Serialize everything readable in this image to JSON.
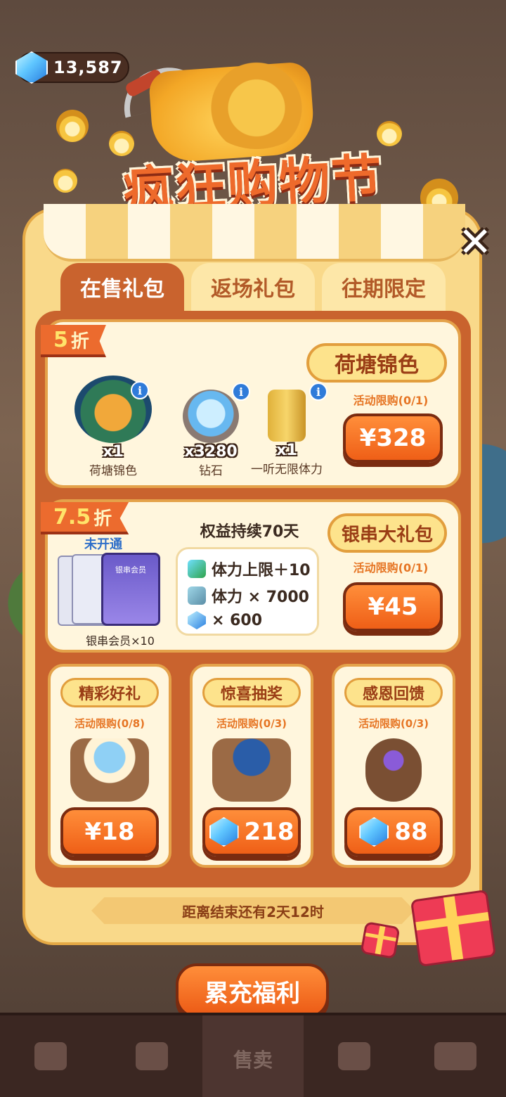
{
  "currency": {
    "amount": "13,587",
    "icon": "diamond-icon"
  },
  "header": {
    "title": "疯狂购物节"
  },
  "close": {
    "label": "✕"
  },
  "tabs": [
    {
      "label": "在售礼包",
      "active": true
    },
    {
      "label": "返场礼包",
      "active": false
    },
    {
      "label": "往期限定",
      "active": false
    }
  ],
  "pack1": {
    "discount_num": "5",
    "discount_unit": "折",
    "name": "荷塘锦色",
    "limit": "活动限购(0/1)",
    "price": "¥328",
    "items": [
      {
        "qty": "x1",
        "label": "荷塘锦色",
        "icon": "koi-fish-icon"
      },
      {
        "qty": "x3280",
        "label": "钻石",
        "icon": "diamond-pile-icon"
      },
      {
        "qty": "x1",
        "label": "一听无限体力",
        "icon": "energy-can-icon"
      }
    ]
  },
  "pack2": {
    "discount_num": "7.5",
    "discount_unit": "折",
    "name": "银串大礼包",
    "limit": "活动限购(0/1)",
    "price": "¥45",
    "status": "未开通",
    "duration": "权益持续70天",
    "member_label": "银串会员×10",
    "card_text": "银串会员",
    "benefits": [
      {
        "text": "体力上限＋10",
        "icon": "energy-up-icon"
      },
      {
        "text": "体力 × 7000",
        "icon": "battery-icon"
      },
      {
        "text": "× 600",
        "icon": "diamond-icon"
      }
    ]
  },
  "small_packs": [
    {
      "title": "精彩好礼",
      "limit": "活动限购(0/8)",
      "price": "¥18",
      "gem": false,
      "icon": "gift-basket-icon"
    },
    {
      "title": "惊喜抽奖",
      "limit": "活动限购(0/3)",
      "price": "218",
      "gem": true,
      "icon": "lottery-basket-icon"
    },
    {
      "title": "感恩回馈",
      "limit": "活动限购(0/3)",
      "price": "88",
      "gem": true,
      "icon": "sack-icon"
    }
  ],
  "countdown": "距离结束还有2天12时",
  "cta": "累充福利",
  "nav": [
    {
      "label": "",
      "icon": "bag-icon"
    },
    {
      "label": "",
      "icon": "cards-icon"
    },
    {
      "label": "售卖",
      "icon": "shop-icon",
      "active": true
    },
    {
      "label": "",
      "icon": "map-pin-icon"
    },
    {
      "label": "",
      "icon": "bus-icon"
    }
  ],
  "colors": {
    "accent": "#ef5f17",
    "panel": "#f9d98a",
    "inner": "#c9632e"
  }
}
